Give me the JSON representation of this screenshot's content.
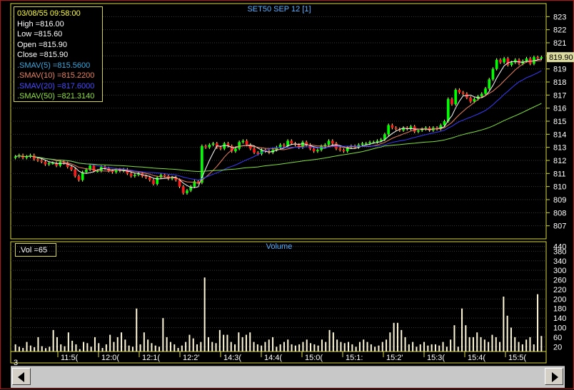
{
  "price_panel": {
    "title": "SET50 SEP 12  [1]"
  },
  "volume_panel": {
    "title": "Volume"
  },
  "info": {
    "datetime": "03/08/55 09:58:00",
    "high": "High   =816.00",
    "low": "Low    =815.60",
    "open": "Open   =815.90",
    "close": "Close  =815.90",
    "sma5": ".SMAV(5)   =815.5600",
    "sma10": ".SMAV(10)  =815.2200",
    "sma20": ".SMAV(20)  =817.6000",
    "sma50": ".SMAV(50)  =821.3140"
  },
  "volume_info": ".Vol   =65",
  "last_price": "819.90",
  "bottom_label": "3",
  "colors": {
    "up": "#00ff00",
    "down": "#ff1a1a",
    "sma5": "#ffffff",
    "sma10": "#e88060",
    "sma20": "#3a3aff",
    "sma50": "#80e040",
    "volume": "#fff8d8",
    "grid": "#3a3a3a"
  },
  "chart_data": [
    {
      "type": "candlestick",
      "title": "SET50 SEP 12  [1]",
      "ylim": [
        806,
        824
      ],
      "y_ticks": [
        807,
        808,
        809,
        810,
        811,
        812,
        813,
        814,
        815,
        816,
        817,
        818,
        819,
        820,
        821,
        822,
        823
      ],
      "time_labels": [
        "11:5(",
        "12:0(",
        "12:1(",
        "12:2'",
        "14:3(",
        "14:4(",
        "15:0(",
        "15:1:",
        "15:2'",
        "15:3(",
        "15:4(",
        "15:5("
      ],
      "close": [
        812.3,
        812.4,
        812.2,
        812.3,
        812.4,
        812.1,
        812.0,
        811.9,
        811.7,
        811.8,
        811.8,
        811.6,
        811.9,
        811.8,
        811.5,
        811.3,
        810.8,
        810.5,
        811.1,
        811.3,
        811.6,
        811.2,
        811.2,
        811.5,
        811.4,
        811.2,
        811.1,
        811.3,
        811.2,
        811.3,
        811.0,
        810.8,
        810.9,
        811.0,
        810.8,
        810.7,
        810.5,
        810.2,
        810.7,
        810.9,
        810.8,
        810.6,
        810.7,
        810.5,
        810.0,
        809.5,
        809.7,
        810.0,
        810.4,
        810.3,
        813.1,
        813.0,
        813.2,
        813.3,
        813.0,
        812.9,
        813.3,
        813.1,
        812.7,
        812.9,
        813.4,
        813.5,
        813.2,
        812.9,
        812.6,
        812.5,
        812.8,
        812.7,
        812.6,
        812.8,
        813.0,
        813.2,
        813.1,
        813.5,
        813.3,
        813.2,
        813.0,
        813.4,
        813.2,
        812.9,
        812.7,
        812.8,
        813.1,
        813.2,
        813.5,
        813.3,
        812.9,
        812.8,
        812.7,
        813.0,
        813.1,
        813.0,
        813.2,
        813.3,
        813.3,
        813.4,
        813.4,
        813.5,
        813.6,
        814.0,
        814.7,
        814.5,
        814.4,
        814.3,
        814.5,
        814.4,
        814.6,
        814.2,
        814.3,
        814.4,
        814.5,
        814.3,
        814.5,
        814.4,
        814.7,
        815.0,
        816.7,
        816.3,
        817.4,
        817.2,
        817.1,
        816.8,
        816.5,
        816.7,
        816.9,
        817.1,
        817.5,
        818.2,
        819.0,
        819.7,
        819.5,
        819.8,
        819.3,
        819.5,
        819.7,
        819.4,
        819.6,
        819.8,
        819.4,
        819.9,
        819.8,
        819.9
      ],
      "sma_periods": [
        5,
        10,
        20,
        50
      ],
      "panel": "price"
    },
    {
      "type": "bar",
      "title": "Volume",
      "ylim": [
        0,
        460
      ],
      "y_ticks": [
        20,
        60,
        100,
        140,
        180,
        220,
        260,
        300,
        340,
        380,
        420,
        440
      ],
      "y_tick_labels": [
        "20",
        "60",
        "100",
        "140",
        "180",
        "200",
        "220",
        "260",
        "300",
        "340",
        "380",
        "440"
      ],
      "values": [
        30,
        20,
        15,
        40,
        25,
        18,
        60,
        22,
        14,
        20,
        90,
        60,
        30,
        22,
        80,
        45,
        30,
        10,
        40,
        35,
        20,
        60,
        35,
        15,
        30,
        70,
        40,
        60,
        80,
        50,
        25,
        20,
        180,
        30,
        80,
        50,
        35,
        25,
        20,
        140,
        60,
        40,
        30,
        15,
        25,
        40,
        70,
        55,
        30,
        40,
        310,
        60,
        40,
        35,
        90,
        70,
        70,
        40,
        30,
        80,
        60,
        70,
        80,
        40,
        30,
        25,
        40,
        50,
        60,
        20,
        30,
        40,
        50,
        30,
        25,
        30,
        40,
        50,
        35,
        30,
        25,
        50,
        40,
        90,
        80,
        50,
        40,
        35,
        40,
        30,
        20,
        40,
        50,
        40,
        30,
        20,
        25,
        40,
        50,
        80,
        120,
        120,
        90,
        60,
        30,
        40,
        20,
        30,
        40,
        25,
        30,
        30,
        25,
        40,
        20,
        50,
        110,
        20,
        180,
        110,
        60,
        60,
        80,
        60,
        50,
        40,
        70,
        60,
        40,
        230,
        150,
        100,
        60,
        40,
        30,
        50,
        60,
        30,
        240,
        65
      ],
      "panel": "volume"
    }
  ]
}
